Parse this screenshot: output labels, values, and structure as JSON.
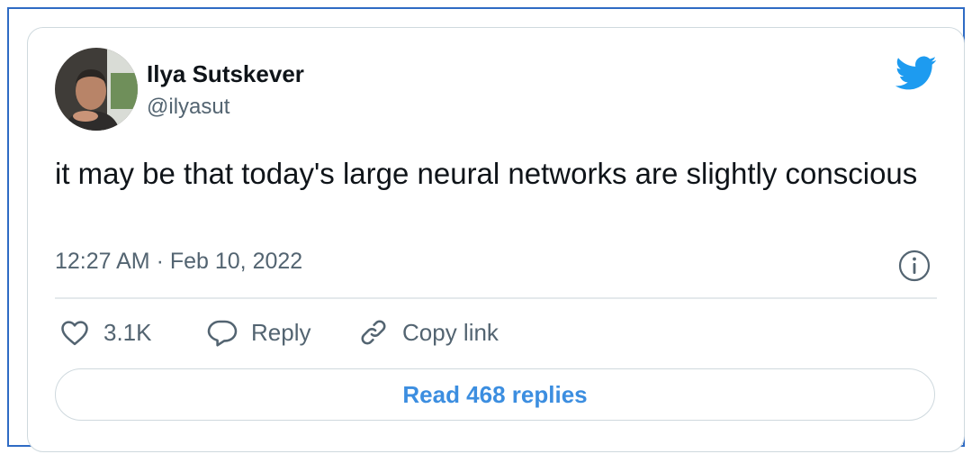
{
  "author": {
    "name": "Ilya Sutskever",
    "handle": "@ilyasut"
  },
  "tweet": {
    "text": "it may be that today's large neural networks are slightly conscious",
    "timestamp": "12:27 AM · Feb 10, 2022"
  },
  "actions": {
    "like_count": "3.1K",
    "reply_label": "Reply",
    "copy_link_label": "Copy link"
  },
  "read_replies_label": "Read 468 replies",
  "icons": {
    "brand": "twitter-bird-icon",
    "info": "info-icon",
    "like": "heart-icon",
    "reply": "speech-bubble-icon",
    "copy": "link-icon"
  },
  "colors": {
    "frame_border": "#2f6bc4",
    "twitter_blue": "#1d9bf0",
    "link_blue": "#3c8ee0",
    "secondary_text": "#536471",
    "primary_text": "#0f1419"
  }
}
